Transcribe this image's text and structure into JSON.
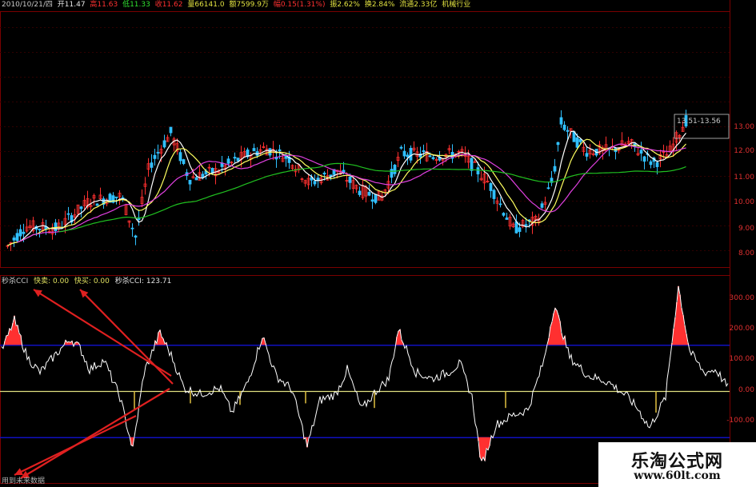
{
  "header": {
    "date": "2010/10/21/四",
    "open": "开11.47",
    "high": "高11.63",
    "low": "低11.33",
    "close": "收11.62",
    "volume": "量66141.0",
    "amount": "额7599.9万",
    "change": "幅0.15(1.31%)",
    "amplitude": "振2.62%",
    "turnover": "换2.84%",
    "float": "流通2.33亿",
    "industry": "机械行业"
  },
  "price_range_label": "13.51-13.56",
  "indicator": {
    "name": "秒杀CCI",
    "sell_label": "快卖: 0.00",
    "buy_label": "快买: 0.00",
    "value_label": "秒杀CCI: 123.71"
  },
  "price_axis": [
    "13.00",
    "12.00",
    "11.00",
    "10.00",
    "9.00",
    "8.00"
  ],
  "cci_axis": [
    "300.00",
    "200.00",
    "100.00",
    "0.00",
    "-100.00"
  ],
  "bottom_text": "用到未来数据",
  "watermark": {
    "title": "乐淘公式网",
    "url": "www.60lt.com"
  },
  "colors": {
    "background": "#000000",
    "up": "#ff3030",
    "down": "#30c0ff",
    "ma5": "#ffffff",
    "ma10": "#ffff60",
    "ma20": "#e040e0",
    "ma60": "#20c020",
    "cci_line": "#ffffff",
    "cci_band": "#1010c0",
    "zero_line": "#e0e080",
    "grid": "#7a0000",
    "arrow": "#e02020"
  }
}
